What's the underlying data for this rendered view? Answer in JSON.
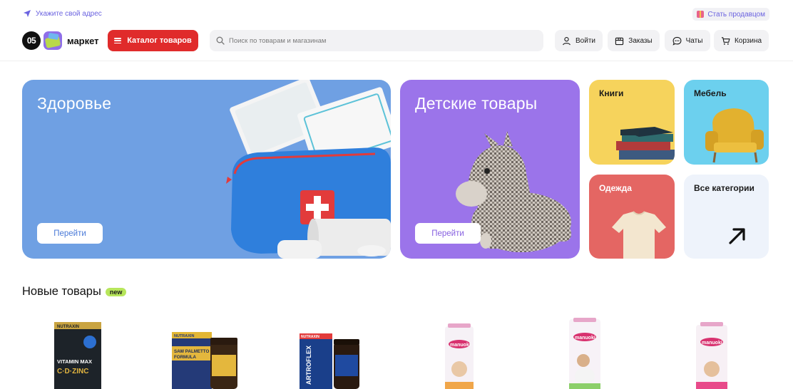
{
  "top": {
    "address_label": "Укажите свой адрес",
    "seller_label": "Стать продавцом"
  },
  "header": {
    "logo_badge": "05",
    "logo_text": "маркет",
    "catalog_label": "Каталог товаров",
    "search_placeholder": "Поиск по товарам и магазинам",
    "login_label": "Войти",
    "orders_label": "Заказы",
    "chats_label": "Чаты",
    "cart_label": "Корзина"
  },
  "banners": {
    "health": {
      "title": "Здоровье",
      "button": "Перейти"
    },
    "kids": {
      "title": "Детские товары",
      "button": "Перейти"
    }
  },
  "tiles": {
    "books": "Книги",
    "furniture": "Мебель",
    "clothes": "Одежда",
    "all": "Все категории"
  },
  "new_products": {
    "title": "Новые товары",
    "badge": "new",
    "items": [
      {
        "brand": "NUTRAXIN",
        "line1": "VITAMIN MAX",
        "line2": "C·D·ZINC"
      },
      {
        "brand": "NUTRAXIN",
        "line1": "SAW PALMETTO",
        "line2": "FORMULA"
      },
      {
        "brand": "NUTRAXIN",
        "line1": "ARTROFLEX",
        "line2": ""
      },
      {
        "brand": "manuoki",
        "line1": "",
        "line2": ""
      },
      {
        "brand": "manuoki",
        "line1": "",
        "line2": ""
      },
      {
        "brand": "manuoki",
        "line1": "",
        "line2": ""
      }
    ]
  },
  "colors": {
    "accent_red": "#e02b2b",
    "link_purple": "#6b63e0",
    "health_bg": "#6fa0e3",
    "kids_bg": "#9b74ea",
    "books_bg": "#f6d35c",
    "furniture_bg": "#6cd0ee",
    "clothes_bg": "#e46663",
    "all_bg": "#eef3fb",
    "new_badge": "#b7e65b"
  }
}
